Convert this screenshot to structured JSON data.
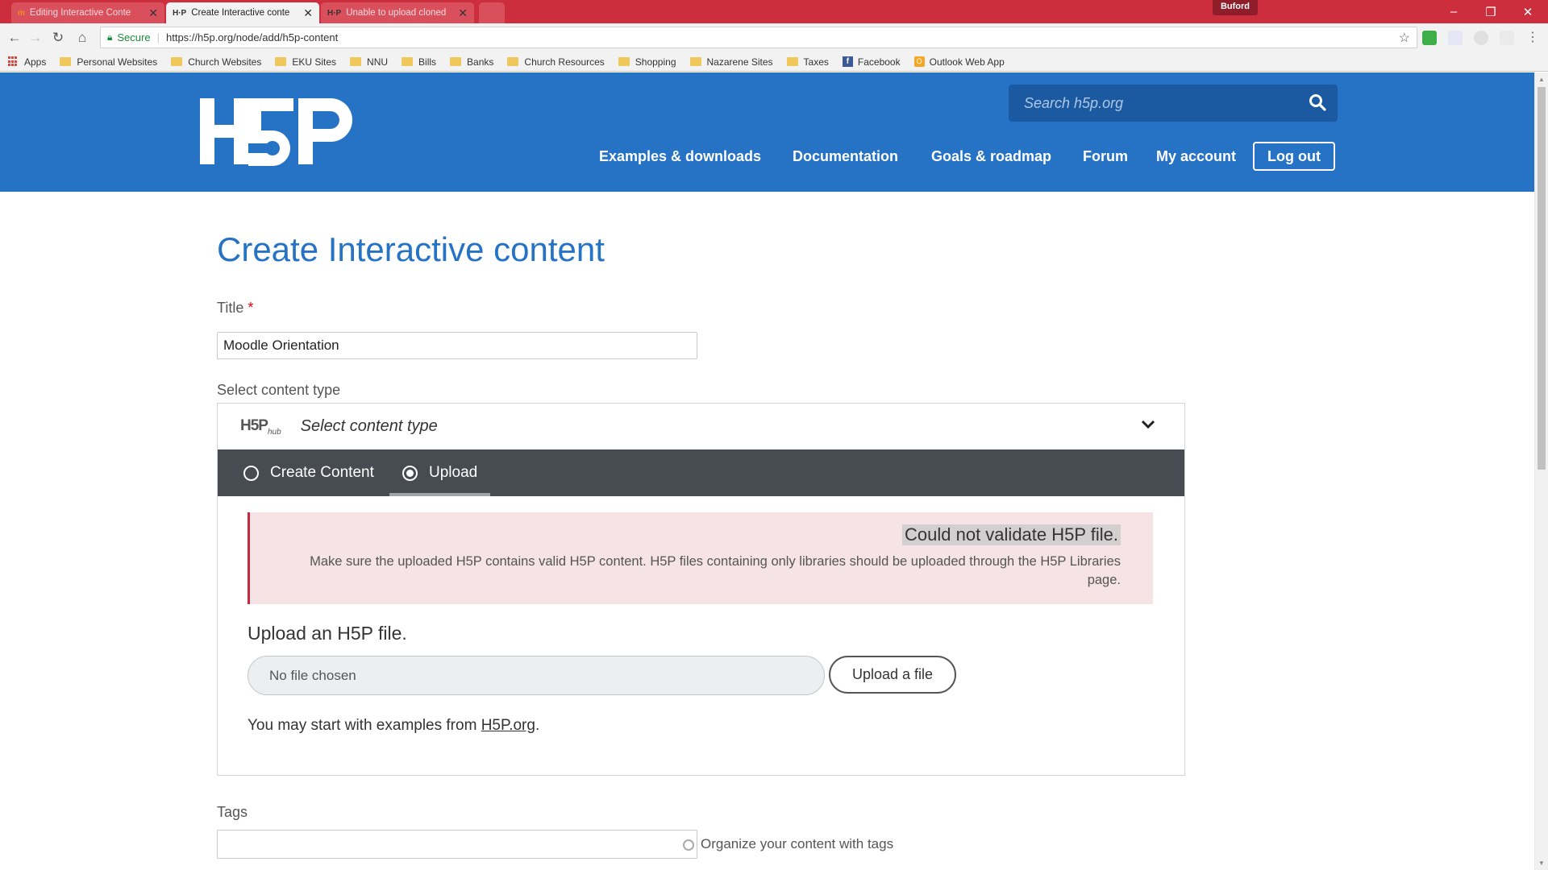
{
  "browser": {
    "tabs": [
      {
        "title": "Editing Interactive Conte",
        "active": false
      },
      {
        "title": "Create Interactive conte",
        "active": true
      },
      {
        "title": "Unable to upload cloned",
        "active": false
      }
    ],
    "profile_name": "Buford",
    "address": {
      "secure_label": "Secure",
      "url": "https://h5p.org/node/add/h5p-content"
    },
    "bookmarks": [
      "Apps",
      "Personal Websites",
      "Church Websites",
      "EKU Sites",
      "NNU",
      "Bills",
      "Banks",
      "Church Resources",
      "Shopping",
      "Nazarene Sites",
      "Taxes",
      "Facebook",
      "Outlook Web App"
    ]
  },
  "site": {
    "logo_text": "H5P",
    "search_placeholder": "Search h5p.org",
    "nav": [
      "Examples & downloads",
      "Documentation",
      "Goals & roadmap",
      "Forum",
      "My account"
    ],
    "logout_label": "Log out",
    "colors": {
      "brand_blue": "#2673c5",
      "search_bg": "#1b5aa0",
      "hub_tabs_bg": "#474b52",
      "error_border": "#c9283e",
      "error_bg": "#f5e3e5"
    }
  },
  "page": {
    "title": "Create Interactive content",
    "title_label": "Title",
    "required_mark": "*",
    "title_value": "Moodle Orientation",
    "content_type_label": "Select content type",
    "hub": {
      "logo": "H5P",
      "logo_sub": "hub",
      "select_label": "Select content type",
      "tabs": [
        "Create Content",
        "Upload"
      ],
      "selected_tab": "Upload"
    },
    "error": {
      "title": "Could not validate H5P file.",
      "body": "Make sure the uploaded H5P contains valid H5P content. H5P files containing only libraries should be uploaded through the H5P Libraries page."
    },
    "upload": {
      "heading": "Upload an H5P file.",
      "file_status": "No file chosen",
      "button": "Upload a file",
      "examples_prefix": "You may start with examples from ",
      "examples_link": "H5P.org",
      "examples_suffix": "."
    },
    "tags": {
      "label": "Tags",
      "help": "Organize your content with tags"
    }
  }
}
